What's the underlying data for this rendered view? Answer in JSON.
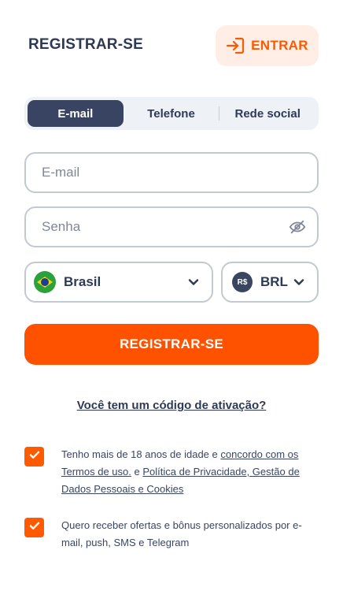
{
  "header": {
    "title": "REGISTRAR-SE",
    "login_label": "ENTRAR"
  },
  "tabs": [
    {
      "label": "E-mail",
      "active": true
    },
    {
      "label": "Telefone",
      "active": false
    },
    {
      "label": "Rede social",
      "active": false
    }
  ],
  "form": {
    "email_placeholder": "E-mail",
    "password_placeholder": "Senha",
    "country": "Brasil",
    "currency_symbol": "R$",
    "currency": "BRL",
    "submit_label": "REGISTRAR-SE",
    "activation_code_link": "Você tem um código de ativação?"
  },
  "consents": {
    "age": {
      "checked": true,
      "text_1": "Tenho mais de 18 anos de idade e ",
      "link_1": "concordo com os Termos de uso.",
      "text_2": " e ",
      "link_2": "Política de Privacidade, Gestão de Dados Pessoais e Cookies"
    },
    "offers": {
      "checked": true,
      "text": "Quero receber ofertas e bônus personalizados por e-mail, push, SMS e Telegram"
    }
  },
  "colors": {
    "accent": "#ff5200",
    "accent_light": "#ffeee6",
    "primary_dark": "#384461",
    "text": "#2e3a55",
    "border": "#c4c9d1"
  },
  "icons": {
    "login": "login-arrow-icon",
    "password_visibility": "eye-off-icon",
    "dropdown": "chevron-down-icon",
    "country_flag": "brazil-flag-icon",
    "currency": "brl-coin-icon",
    "checkbox": "check-icon"
  }
}
